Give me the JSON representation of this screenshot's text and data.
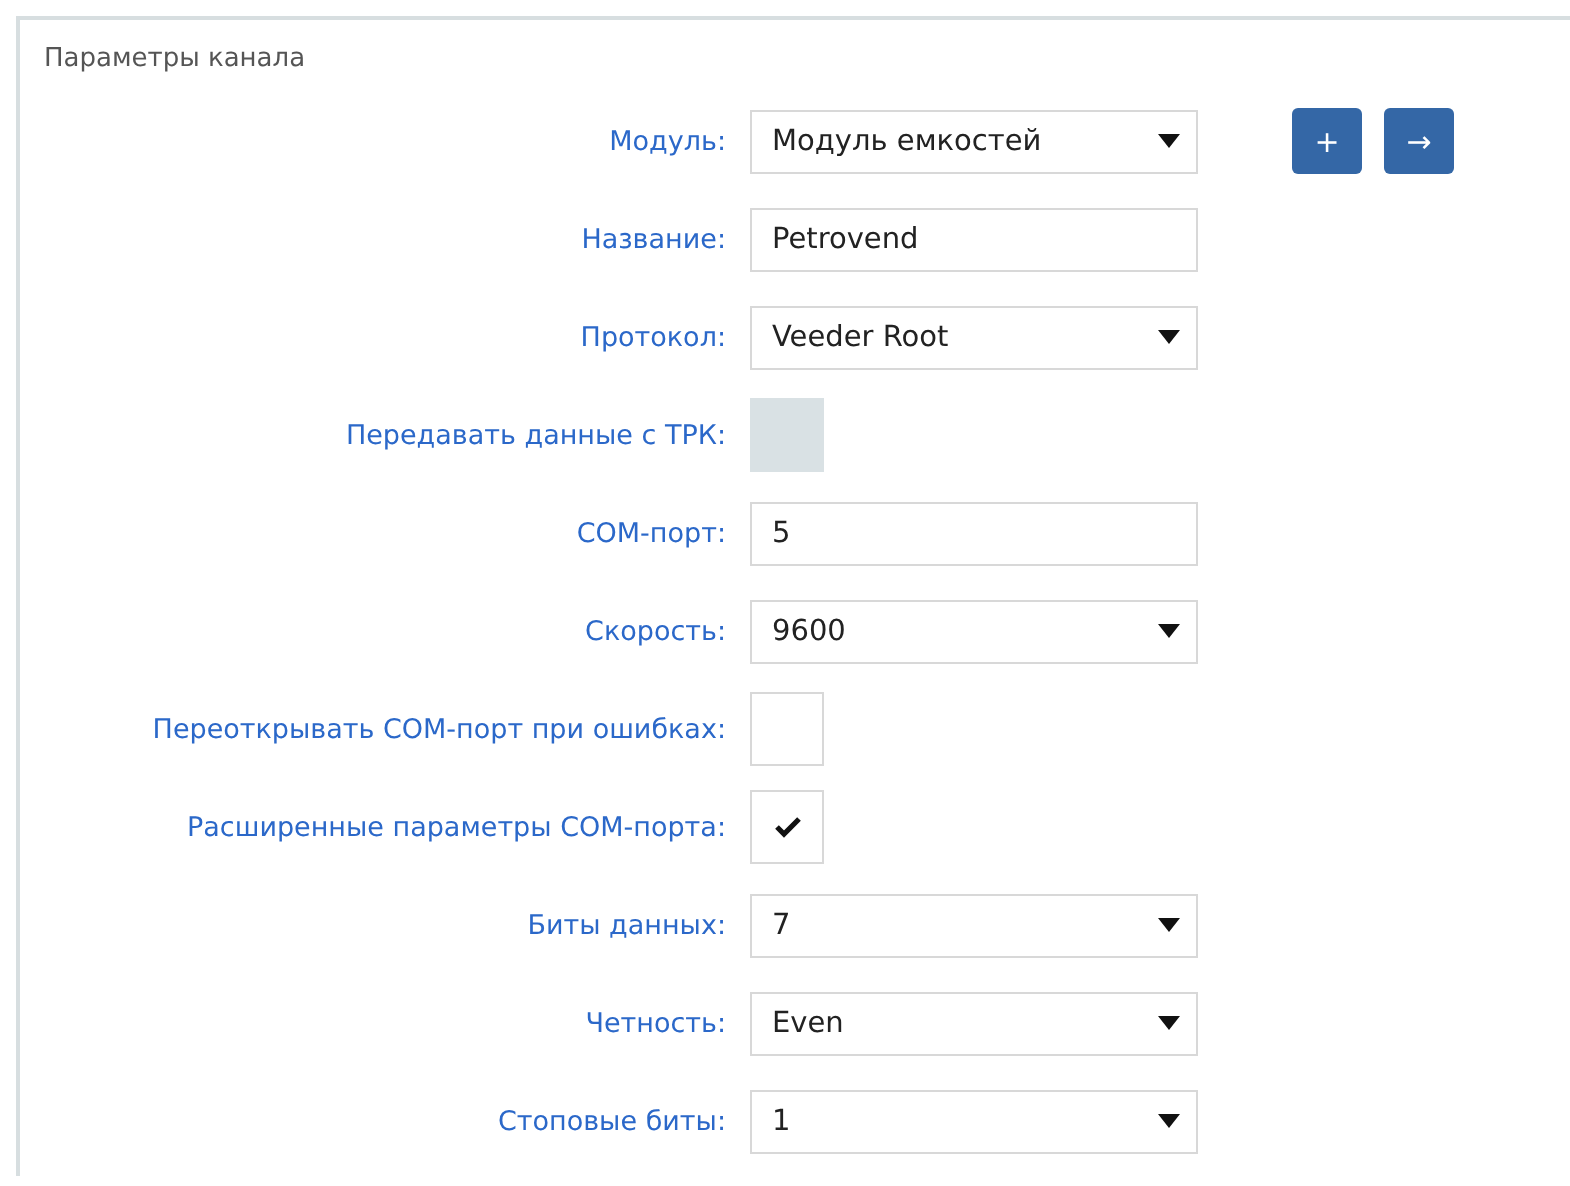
{
  "panel": {
    "title": "Параметры канала"
  },
  "fields": [
    {
      "kind": "select",
      "label": "Модуль:",
      "value": "Модуль емкостей"
    },
    {
      "kind": "text",
      "label": "Название:",
      "value": "Petrovend"
    },
    {
      "kind": "select",
      "label": "Протокол:",
      "value": "Veeder Root"
    },
    {
      "kind": "checkbox",
      "label": "Передавать данные с ТРК:",
      "checked": false,
      "disabled": true
    },
    {
      "kind": "text",
      "label": "COM-порт:",
      "value": "5"
    },
    {
      "kind": "select",
      "label": "Скорость:",
      "value": "9600"
    },
    {
      "kind": "checkbox",
      "label": "Переоткрывать COM-порт при ошибках:",
      "checked": false,
      "disabled": false
    },
    {
      "kind": "checkbox",
      "label": "Расширенные параметры COM-порта:",
      "checked": true,
      "disabled": false
    },
    {
      "kind": "select",
      "label": "Биты данных:",
      "value": "7"
    },
    {
      "kind": "select",
      "label": "Четность:",
      "value": "Even"
    },
    {
      "kind": "select",
      "label": "Стоповые биты:",
      "value": "1"
    }
  ],
  "module_buttons": [
    "+",
    "→"
  ]
}
